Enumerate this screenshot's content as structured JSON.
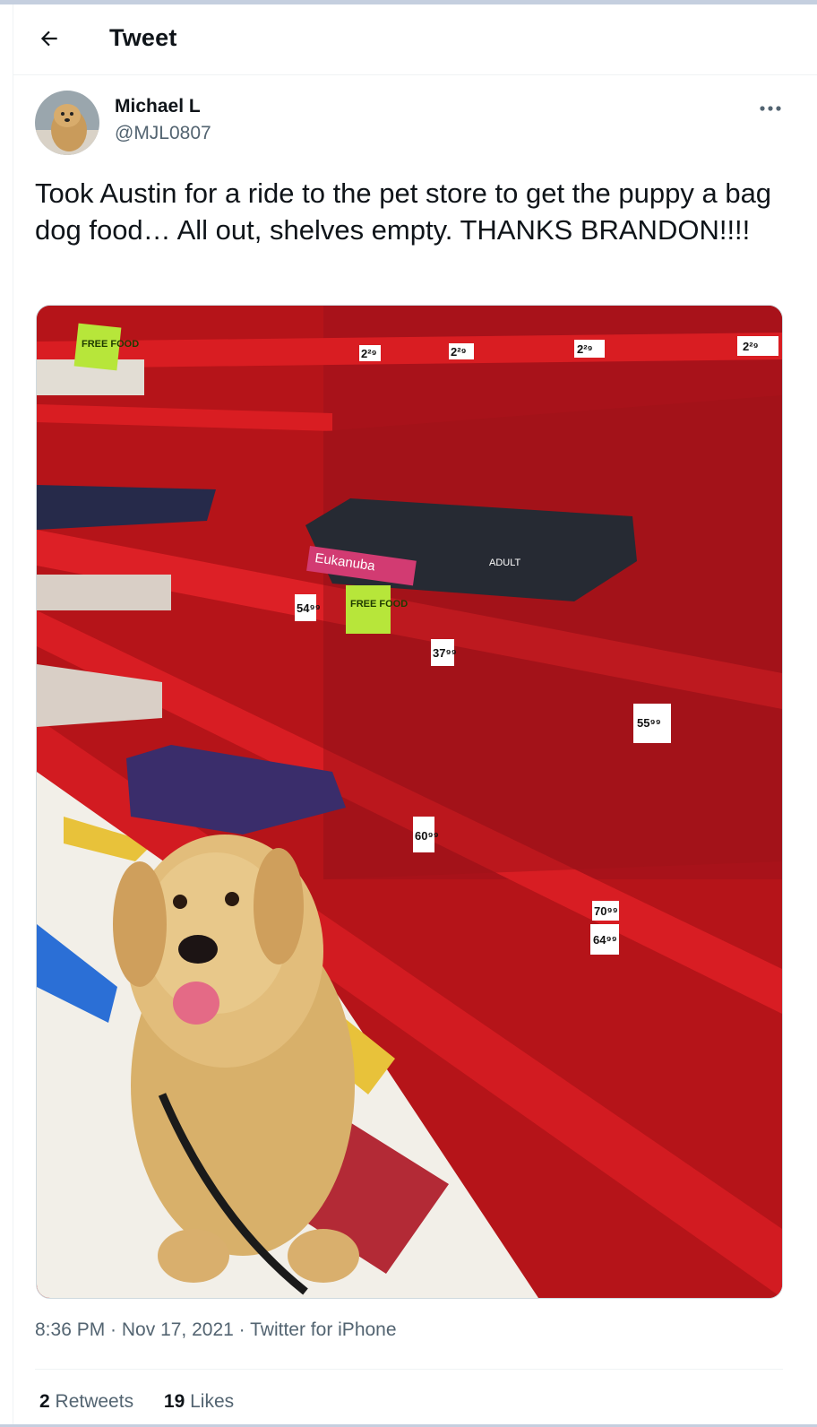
{
  "header": {
    "title": "Tweet"
  },
  "icons": {
    "back": "arrow-left-icon",
    "more": "more-horizontal-icon"
  },
  "author": {
    "display_name": "Michael L",
    "handle": "@MJL0807"
  },
  "tweet": {
    "text": "Took Austin for a ride to the pet store to get the puppy a bag dog food… All out, shelves empty. THANKS BRANDON!!!!",
    "time": "8:36 PM",
    "date": "Nov 17, 2021",
    "source": "Twitter for iPhone",
    "separator": " · "
  },
  "photo": {
    "free_food_label": "FREE FOOD",
    "brand_label": "Eukanuba",
    "adult_label": "ADULT",
    "price_tags": [
      "2²⁹",
      "2²⁹",
      "2²⁹",
      "2²⁹",
      "54⁹⁹",
      "37⁹⁹",
      "55⁹⁹",
      "64⁹⁹",
      "60⁹⁹",
      "70⁹⁹"
    ]
  },
  "stats": {
    "retweets_count": "2",
    "retweets_label": "Retweets",
    "likes_count": "19",
    "likes_label": "Likes"
  },
  "colors": {
    "text": "#0f1419",
    "secondary": "#536471",
    "border": "#eff3f4",
    "shelf_red": "#c8141b"
  }
}
